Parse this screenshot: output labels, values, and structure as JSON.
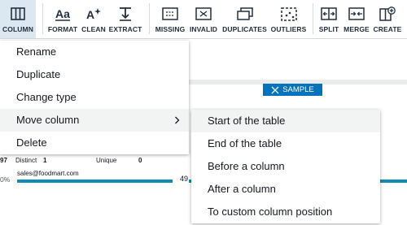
{
  "toolbar": {
    "buttons": [
      {
        "id": "column",
        "label": "COLUMN"
      },
      {
        "id": "format",
        "label": "FORMAT"
      },
      {
        "id": "clean",
        "label": "CLEAN"
      },
      {
        "id": "extract",
        "label": "EXTRACT"
      },
      {
        "id": "missing",
        "label": "MISSING"
      },
      {
        "id": "invalid",
        "label": "INVALID"
      },
      {
        "id": "duplicates",
        "label": "DUPLICATES"
      },
      {
        "id": "outliers",
        "label": "OUTLIERS"
      },
      {
        "id": "split",
        "label": "SPLIT"
      },
      {
        "id": "merge",
        "label": "MERGE"
      },
      {
        "id": "create",
        "label": "CREATE"
      }
    ]
  },
  "column_menu": {
    "items": [
      "Rename",
      "Duplicate",
      "Change type",
      "Move column",
      "Delete"
    ],
    "hovered": "Move column"
  },
  "move_submenu": {
    "items": [
      "Start of the table",
      "End of the table",
      "Before a column",
      "After a column",
      "To custom column position"
    ],
    "hovered": "Start of the table"
  },
  "grid": {
    "sample_badge": "SAMPLE",
    "row_count": "97",
    "distinct_label": "Distinct",
    "distinct_value": "1",
    "unique_label": "Unique",
    "unique_value": "0",
    "left_percent": "0%",
    "value": "sales@foodmart.com",
    "partial_count": "49"
  },
  "colors": {
    "accent": "#0073bb",
    "bar": "#0f8bb5",
    "active_tab_bg": "#dbe8f1"
  }
}
